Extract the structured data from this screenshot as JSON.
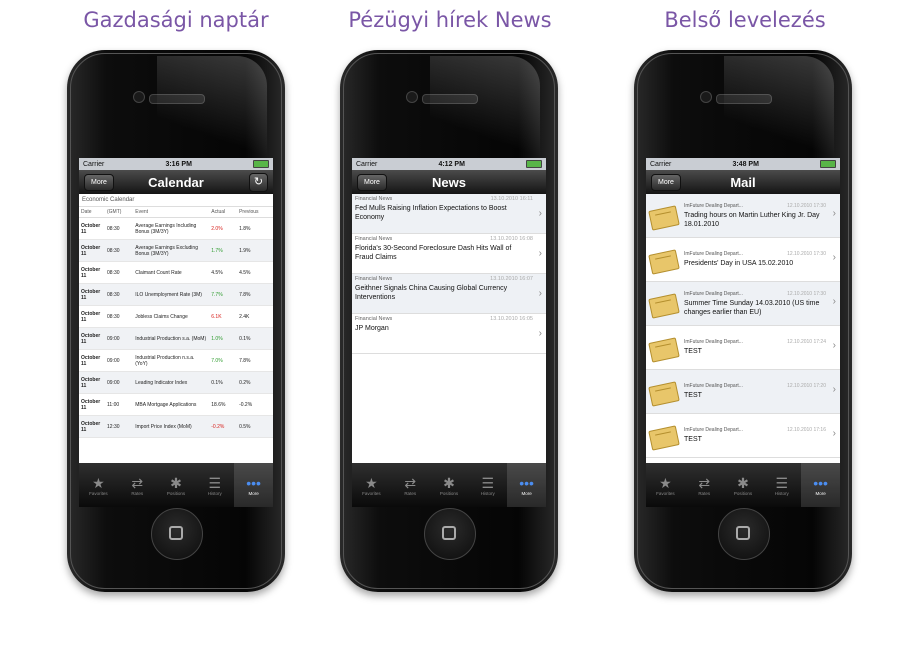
{
  "captions": [
    "Gazdasági naptár",
    "Pézügyi hírek News",
    "Belső levelezés"
  ],
  "common": {
    "carrier": "Carrier",
    "back_label": "More",
    "tabs": [
      {
        "label": "Favorites",
        "icon": "star-icon"
      },
      {
        "label": "Rates",
        "icon": "arrows-icon"
      },
      {
        "label": "Positions",
        "icon": "gear-icon"
      },
      {
        "label": "History",
        "icon": "list-icon"
      },
      {
        "label": "More",
        "icon": "more-icon"
      }
    ]
  },
  "calendar": {
    "time": "3:16 PM",
    "title": "Calendar",
    "section": "Economic Calendar",
    "columns": [
      "Date",
      "(GMT)",
      "Event",
      "Actual",
      "Previous"
    ],
    "rows": [
      {
        "date": "October 11",
        "time": "08:30",
        "event": "Average Earnings Including Bonus (3M/3Y)",
        "actual": "2.0%",
        "trend": "neg",
        "previous": "1.8%"
      },
      {
        "date": "October 11",
        "time": "08:30",
        "event": "Average Earnings Excluding Bonus (3M/3Y)",
        "actual": "1.7%",
        "trend": "pos",
        "previous": "1.9%"
      },
      {
        "date": "October 11",
        "time": "08:30",
        "event": "Claimant Count Rate",
        "actual": "4.5%",
        "trend": "",
        "previous": "4.5%"
      },
      {
        "date": "October 11",
        "time": "08:30",
        "event": "ILO Unemployment Rate (3M)",
        "actual": "7.7%",
        "trend": "pos",
        "previous": "7.8%"
      },
      {
        "date": "October 11",
        "time": "08:30",
        "event": "Jobless Claims Change",
        "actual": "6.1K",
        "trend": "neg",
        "previous": "2.4K"
      },
      {
        "date": "October 11",
        "time": "09:00",
        "event": "Industrial Production s.a. (MoM)",
        "actual": "1.0%",
        "trend": "pos",
        "previous": "0.1%"
      },
      {
        "date": "October 11",
        "time": "09:00",
        "event": "Industrial Production n.s.a. (YoY)",
        "actual": "7.0%",
        "trend": "pos",
        "previous": "7.8%"
      },
      {
        "date": "October 11",
        "time": "09:00",
        "event": "Leading Indicator Index",
        "actual": "0.1%",
        "trend": "",
        "previous": "0.2%"
      },
      {
        "date": "October 11",
        "time": "11:00",
        "event": "MBA Mortgage Applications",
        "actual": "18.6%",
        "trend": "",
        "previous": "-0.2%"
      },
      {
        "date": "October 11",
        "time": "12:30",
        "event": "Import Price Index (MoM)",
        "actual": "-0.2%",
        "trend": "neg",
        "previous": "0.5%"
      }
    ]
  },
  "news": {
    "time": "4:12 PM",
    "title": "News",
    "items": [
      {
        "source": "Financial News",
        "date": "13.10.2010 16:11",
        "title": "Fed Mulls Raising Inflation Expectations to Boost Economy"
      },
      {
        "source": "Financial News",
        "date": "13.10.2010 16:08",
        "title": "Florida's 30-Second Foreclosure Dash Hits Wall of Fraud Claims"
      },
      {
        "source": "Financial News",
        "date": "13.10.2010 16:07",
        "title": "Geithner Signals China Causing Global Currency Interventions"
      },
      {
        "source": "Financial News",
        "date": "13.10.2010 16:05",
        "title": "JP Morgan"
      }
    ]
  },
  "mail": {
    "time": "3:48 PM",
    "title": "Mail",
    "items": [
      {
        "from": "ImFuture Dealing Depart...",
        "date": "12.10.2010 17:30",
        "subject": "Trading hours on Martin Luther King Jr. Day 18.01.2010"
      },
      {
        "from": "ImFuture Dealing Depart...",
        "date": "12.10.2010 17:30",
        "subject": "Presidents' Day in USA 15.02.2010"
      },
      {
        "from": "ImFuture Dealing Depart...",
        "date": "12.10.2010 17:30",
        "subject": "Summer Time Sunday 14.03.2010 (US time changes earlier than EU)"
      },
      {
        "from": "ImFuture Dealing Depart...",
        "date": "12.10.2010 17:24",
        "subject": "TEST"
      },
      {
        "from": "ImFuture Dealing Depart...",
        "date": "12.10.2010 17:20",
        "subject": "TEST"
      },
      {
        "from": "ImFuture Dealing Depart...",
        "date": "12.10.2010 17:16",
        "subject": "TEST"
      }
    ]
  }
}
